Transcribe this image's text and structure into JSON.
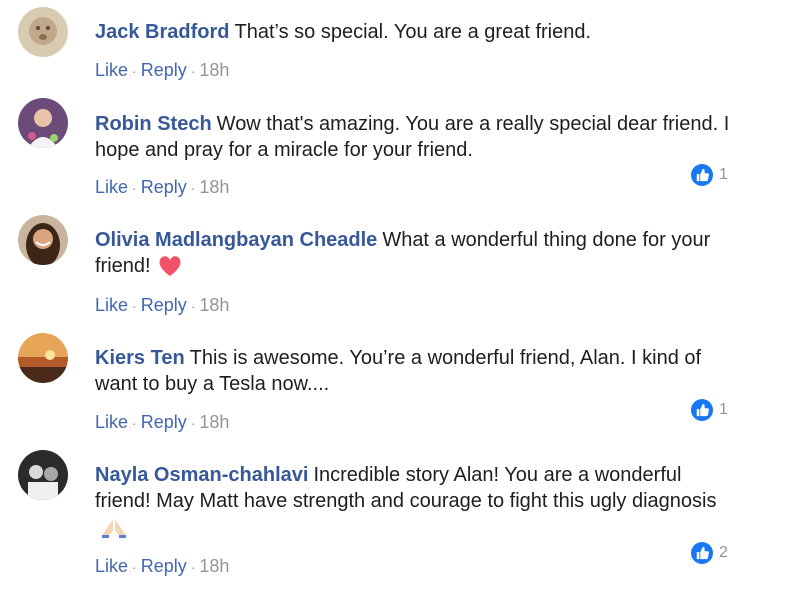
{
  "comments": [
    {
      "author": "Jack Bradford",
      "text": "That’s so special. You are a great friend.",
      "actions": {
        "like": "Like",
        "reply": "Reply",
        "time": "18h"
      }
    },
    {
      "author": "Robin Stech",
      "text": "Wow that's amazing. You are a really special dear friend. I hope and pray for a miracle for your friend.",
      "actions": {
        "like": "Like",
        "reply": "Reply",
        "time": "18h"
      },
      "reaction_count": "1"
    },
    {
      "author": "Olivia Madlangbayan Cheadle",
      "text": "What a wonderful thing done for your friend!",
      "actions": {
        "like": "Like",
        "reply": "Reply",
        "time": "18h"
      },
      "emoji": "heart-emoji"
    },
    {
      "author": "Kiers Ten",
      "text": "This is awesome. You’re a wonderful friend, Alan. I kind of want to buy a Tesla now....",
      "actions": {
        "like": "Like",
        "reply": "Reply",
        "time": "18h"
      },
      "reaction_count": "1"
    },
    {
      "author": "Nayla Osman-chahlavi",
      "text": "Incredible story Alan! You are a wonderful friend! May Matt have strength and courage to fight this ugly diagnosis",
      "actions": {
        "like": "Like",
        "reply": "Reply",
        "time": "18h"
      },
      "reaction_count": "2",
      "emoji": "pray-emoji"
    }
  ],
  "colors": {
    "author": "#365899",
    "link": "#4267b2",
    "meta": "#90949c",
    "like_reaction": "#1877f2",
    "heart": "#f25268"
  },
  "icons": {
    "reaction": "thumbs-up-icon"
  }
}
